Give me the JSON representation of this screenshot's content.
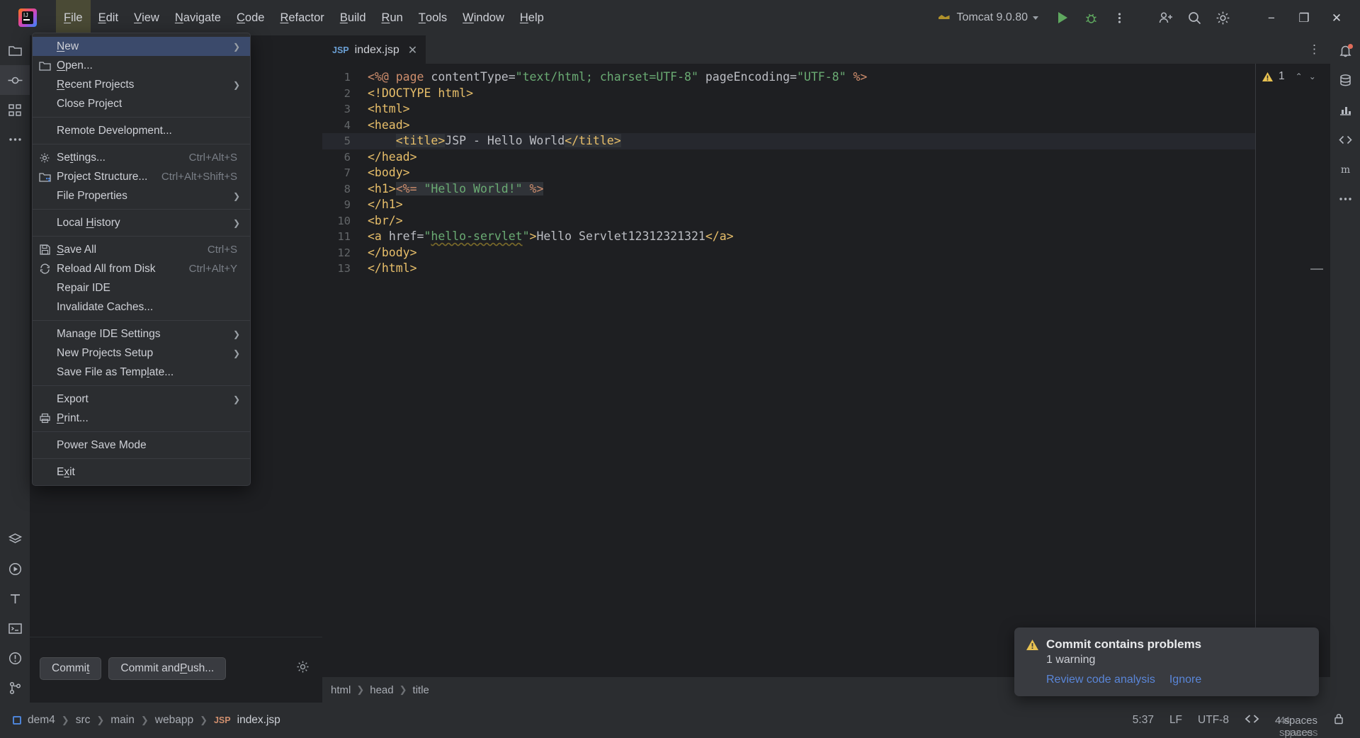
{
  "window": {
    "logo_name": "intellij-idea-logo",
    "menus": [
      {
        "label": "File",
        "mnemonic": "F",
        "active": true
      },
      {
        "label": "Edit",
        "mnemonic": "E",
        "active": false
      },
      {
        "label": "View",
        "mnemonic": "V",
        "active": false
      },
      {
        "label": "Navigate",
        "mnemonic": "N",
        "active": false
      },
      {
        "label": "Code",
        "mnemonic": "C",
        "active": false
      },
      {
        "label": "Refactor",
        "mnemonic": "R",
        "active": false
      },
      {
        "label": "Build",
        "mnemonic": "B",
        "active": false
      },
      {
        "label": "Run",
        "mnemonic": "R",
        "active": false
      },
      {
        "label": "Tools",
        "mnemonic": "T",
        "active": false
      },
      {
        "label": "Window",
        "mnemonic": "W",
        "active": false
      },
      {
        "label": "Help",
        "mnemonic": "H",
        "active": false
      }
    ],
    "run_config": "Tomcat 9.0.80",
    "controls": {
      "minimize": "−",
      "maximize": "❐",
      "close": "✕"
    }
  },
  "file_menu": {
    "items": [
      {
        "label": "New",
        "mnemonic": "N",
        "icon": "",
        "shortcut": "",
        "submenu": true,
        "highlighted": true,
        "sep_after": false
      },
      {
        "label": "Open...",
        "mnemonic": "O",
        "icon": "folder-icon",
        "shortcut": "",
        "submenu": false,
        "highlighted": false,
        "sep_after": false
      },
      {
        "label": "Recent Projects",
        "mnemonic": "R",
        "icon": "",
        "shortcut": "",
        "submenu": true,
        "highlighted": false,
        "sep_after": false
      },
      {
        "label": "Close Project",
        "mnemonic": "",
        "icon": "",
        "shortcut": "",
        "submenu": false,
        "highlighted": false,
        "sep_after": true
      },
      {
        "label": "Remote Development...",
        "mnemonic": "",
        "icon": "",
        "shortcut": "",
        "submenu": false,
        "highlighted": false,
        "sep_after": true
      },
      {
        "label": "Settings...",
        "mnemonic": "t",
        "icon": "gear-icon",
        "shortcut": "Ctrl+Alt+S",
        "submenu": false,
        "highlighted": false,
        "sep_after": false
      },
      {
        "label": "Project Structure...",
        "mnemonic": "",
        "icon": "project-structure-icon",
        "shortcut": "Ctrl+Alt+Shift+S",
        "submenu": false,
        "highlighted": false,
        "sep_after": false
      },
      {
        "label": "File Properties",
        "mnemonic": "",
        "icon": "",
        "shortcut": "",
        "submenu": true,
        "highlighted": false,
        "sep_after": true
      },
      {
        "label": "Local History",
        "mnemonic": "H",
        "icon": "",
        "shortcut": "",
        "submenu": true,
        "highlighted": false,
        "sep_after": true
      },
      {
        "label": "Save All",
        "mnemonic": "S",
        "icon": "save-icon",
        "shortcut": "Ctrl+S",
        "submenu": false,
        "highlighted": false,
        "sep_after": false
      },
      {
        "label": "Reload All from Disk",
        "mnemonic": "",
        "icon": "reload-icon",
        "shortcut": "Ctrl+Alt+Y",
        "submenu": false,
        "highlighted": false,
        "sep_after": false
      },
      {
        "label": "Repair IDE",
        "mnemonic": "",
        "icon": "",
        "shortcut": "",
        "submenu": false,
        "highlighted": false,
        "sep_after": false
      },
      {
        "label": "Invalidate Caches...",
        "mnemonic": "",
        "icon": "",
        "shortcut": "",
        "submenu": false,
        "highlighted": false,
        "sep_after": true
      },
      {
        "label": "Manage IDE Settings",
        "mnemonic": "",
        "icon": "",
        "shortcut": "",
        "submenu": true,
        "highlighted": false,
        "sep_after": false
      },
      {
        "label": "New Projects Setup",
        "mnemonic": "",
        "icon": "",
        "shortcut": "",
        "submenu": true,
        "highlighted": false,
        "sep_after": false
      },
      {
        "label": "Save File as Template...",
        "mnemonic": "l",
        "icon": "",
        "shortcut": "",
        "submenu": false,
        "highlighted": false,
        "sep_after": true
      },
      {
        "label": "Export",
        "mnemonic": "",
        "icon": "",
        "shortcut": "",
        "submenu": true,
        "highlighted": false,
        "sep_after": false
      },
      {
        "label": "Print...",
        "mnemonic": "P",
        "icon": "print-icon",
        "shortcut": "",
        "submenu": false,
        "highlighted": false,
        "sep_after": true
      },
      {
        "label": "Power Save Mode",
        "mnemonic": "",
        "icon": "",
        "shortcut": "",
        "submenu": false,
        "highlighted": false,
        "sep_after": true
      },
      {
        "label": "Exit",
        "mnemonic": "x",
        "icon": "",
        "shortcut": "",
        "submenu": false,
        "highlighted": false,
        "sep_after": false
      }
    ]
  },
  "editor": {
    "tab": {
      "badge": "JSP",
      "label": "index.jsp",
      "close": "✕"
    },
    "more": "⋮",
    "lines": [
      {
        "n": "1",
        "current": false
      },
      {
        "n": "2",
        "current": false
      },
      {
        "n": "3",
        "current": false
      },
      {
        "n": "4",
        "current": false
      },
      {
        "n": "5",
        "current": true
      },
      {
        "n": "6",
        "current": false
      },
      {
        "n": "7",
        "current": false
      },
      {
        "n": "8",
        "current": false
      },
      {
        "n": "9",
        "current": false
      },
      {
        "n": "10",
        "current": false
      },
      {
        "n": "11",
        "current": false
      },
      {
        "n": "12",
        "current": false
      },
      {
        "n": "13",
        "current": false
      }
    ],
    "source": [
      "<%@ page contentType=\"text/html; charset=UTF-8\" pageEncoding=\"UTF-8\" %>",
      "<!DOCTYPE html>",
      "<html>",
      "<head>",
      "    <title>JSP - Hello World</title>",
      "</head>",
      "<body>",
      "<h1><%= \"Hello World!\" %>",
      "</h1>",
      "<br/>",
      "<a href=\"hello-servlet\">Hello Servlet12312321321</a>",
      "</body>",
      "</html>"
    ],
    "inspection": {
      "warning_count": "1",
      "up": "⌃",
      "down": "⌄"
    },
    "breadcrumbs": [
      "html",
      "head",
      "title"
    ]
  },
  "commit_panel": {
    "commit_label": "Commit",
    "commit_mnemonic": "t",
    "commit_and_push_label": "Commit and Push...",
    "commit_and_push_mnemonic": "P",
    "settings_icon": "gear-icon"
  },
  "notification": {
    "icon": "warning-triangle-icon",
    "title": "Commit contains problems",
    "subtitle": "1 warning",
    "links": [
      "Review code analysis",
      "Ignore"
    ]
  },
  "statusbar": {
    "project": "dem4",
    "path": [
      "src",
      "main",
      "webapp"
    ],
    "file_badge": "JSP",
    "file": "index.jsp",
    "caret": "5:37",
    "line_separator": "LF",
    "encoding": "UTF-8",
    "indent": "4 spaces"
  },
  "left_rail": {
    "icons": [
      "project-folder-icon",
      "commit-icon",
      "structure-icon",
      "more-tools-icon",
      "services-layers-icon",
      "run-icon",
      "terminal-t-icon",
      "terminal-icon",
      "problems-icon",
      "git-branch-icon"
    ]
  },
  "right_rail": {
    "icons": [
      "notifications-bell-icon",
      "database-icon",
      "profiler-icon",
      "code-with-me-icon",
      "maven-icon",
      "more-icon"
    ]
  },
  "colors": {
    "accent_blue": "#3b4a6b",
    "warning_yellow": "#e8c251",
    "link_blue": "#5a86d8",
    "tag_orange": "#e8bf6a",
    "string_green": "#6aab73",
    "keyword_orange": "#cf8e6d",
    "panel_bg": "#2b2d30",
    "editor_bg": "#1e1f22"
  }
}
